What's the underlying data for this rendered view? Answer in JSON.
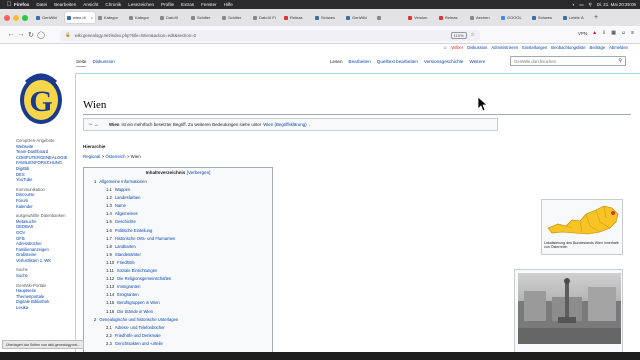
{
  "menubar": {
    "app": "Firefox",
    "items": [
      "Datei",
      "Bearbeiten",
      "Ansicht",
      "Chronik",
      "Lesezeichen",
      "Profile",
      "Extras",
      "Fenster",
      "Hilfe"
    ],
    "clock": "Di. 21. Mai 20:39:05"
  },
  "tabs": [
    {
      "label": "GenWiki",
      "color": "#3b6ea5"
    },
    {
      "label": "wien.di",
      "color": "#3b6ea5",
      "active": true
    },
    {
      "label": "Kategor",
      "color": "#888888"
    },
    {
      "label": "Kategor",
      "color": "#888888"
    },
    {
      "label": "DatoXI",
      "color": "#888888"
    },
    {
      "label": "Schilter",
      "color": "#888888"
    },
    {
      "label": "Schilter",
      "color": "#888888"
    },
    {
      "label": "DatoXI Fi",
      "color": "#888888"
    },
    {
      "label": "Releas",
      "color": "#d33"
    },
    {
      "label": "Schwes",
      "color": "#3b6ea5"
    },
    {
      "label": "GenWiki",
      "color": "#3b6ea5"
    },
    {
      "label": "",
      "color": "#888888"
    },
    {
      "label": "Version",
      "color": "#d33"
    },
    {
      "label": "Releas",
      "color": "#d33"
    },
    {
      "label": "Aechen",
      "color": "#888888"
    },
    {
      "label": "GOOGL",
      "color": "#4285f4"
    },
    {
      "label": "Schwes",
      "color": "#3b6ea5"
    },
    {
      "label": "Letzte Ä",
      "color": "#3b6ea5"
    }
  ],
  "toolbar": {
    "url": "wiki.genealogy.net/index.php?title=Wien&action=edit&section=0",
    "zoom": "110%",
    "vpn_label": "VPN"
  },
  "personal": {
    "user": "Wilber",
    "items": [
      "Diskussion",
      "Administrieren",
      "Einstellungen",
      "Beobachtungsliste",
      "Beiträge",
      "Abmelden"
    ]
  },
  "page_tabs": {
    "left": [
      "Seite",
      "Diskussion"
    ],
    "right": [
      "Lesen",
      "Bearbeiten",
      "Quelltext bearbeiten",
      "Versionsgeschichte",
      "Weitere"
    ],
    "selected_left": "Seite",
    "selected_right": "Lesen"
  },
  "search": {
    "placeholder": "GenWiki durchsuchen"
  },
  "sidebar": {
    "groups": [
      {
        "title": "CompGen-Angebote",
        "links": [
          "Webseite",
          "Team-Dashboard",
          "COMPUTERGENEALOGIE",
          "FAMILIENFORSCHUNG",
          "DigiBib",
          "DES",
          "YouTube"
        ]
      },
      {
        "title": "Kommunikation",
        "links": [
          "Discourse",
          "Forum",
          "Kalender"
        ]
      },
      {
        "title": "ausgewählte Datenbanken",
        "links": [
          "Metasuche",
          "GEDBAS",
          "GOV",
          "OFB",
          "Adressbücher",
          "Familienanzeigen",
          "Grabsteine",
          "Verlustlisten 1. WK"
        ]
      },
      {
        "title": "Suche",
        "links": [
          "Suche"
        ]
      },
      {
        "title": "GenWiki-Portale",
        "links": [
          "Hauptseite",
          "Themenportale",
          "Digitale Bibliothek",
          "Lexika"
        ]
      }
    ]
  },
  "page": {
    "title": "Wien",
    "hatnote_bold": "Wien",
    "hatnote_text": " ist ein mehrfach besetzter Begriff. Zu weiteren Bedeutungen siehe unter ",
    "hatnote_link": "Wien (Begriffsklärung)",
    "hatnote_end": ".",
    "hierarchy_heading": "Hierarchie",
    "breadcrumb": [
      "Regional",
      "Österreich",
      "Wien"
    ]
  },
  "toc": {
    "title": "Inhaltsverzeichnis",
    "hide": "[Verbergen]",
    "items": [
      {
        "num": "1",
        "text": "Allgemeine Informationen",
        "level": 1
      },
      {
        "num": "1.1",
        "text": "Wappen",
        "level": 2
      },
      {
        "num": "1.2",
        "text": "Landesfarben",
        "level": 2
      },
      {
        "num": "1.3",
        "text": "Name",
        "level": 2
      },
      {
        "num": "1.4",
        "text": "Allgemeines",
        "level": 2
      },
      {
        "num": "1.5",
        "text": "Geschichte",
        "level": 2
      },
      {
        "num": "1.6",
        "text": "Politische Einteilung",
        "level": 2
      },
      {
        "num": "1.7",
        "text": "Historische Orts- und Flurnamen",
        "level": 2
      },
      {
        "num": "1.8",
        "text": "Landkarten",
        "level": 2
      },
      {
        "num": "1.9",
        "text": "Standesämter",
        "level": 2
      },
      {
        "num": "1.10",
        "text": "Friedhöfe",
        "level": 2
      },
      {
        "num": "1.11",
        "text": "Soziale Einrichtungen",
        "level": 2
      },
      {
        "num": "1.12",
        "text": "Die Religionsgemeinschaften",
        "level": 2
      },
      {
        "num": "1.13",
        "text": "Immigranten",
        "level": 2
      },
      {
        "num": "1.14",
        "text": "Emigranten",
        "level": 2
      },
      {
        "num": "1.15",
        "text": "Berufsgruppen in Wien",
        "level": 2
      },
      {
        "num": "1.16",
        "text": "Die Stände in Wien",
        "level": 2
      },
      {
        "num": "2",
        "text": "Genealogische und historische Unterlagen",
        "level": 1
      },
      {
        "num": "2.1",
        "text": "Adress- und Telefonbücher",
        "level": 2
      },
      {
        "num": "2.2",
        "text": "Friedhöfe und Denkmale",
        "level": 2
      },
      {
        "num": "2.3",
        "text": "Gerichtsakten und -urteile",
        "level": 2
      }
    ]
  },
  "infobox_map": {
    "caption": "Lokalisierung des Bundeslands Wien innerhalb von Österreich"
  },
  "status_tip": "Überlagert dar Seiten von wiki.genealogy.net..."
}
